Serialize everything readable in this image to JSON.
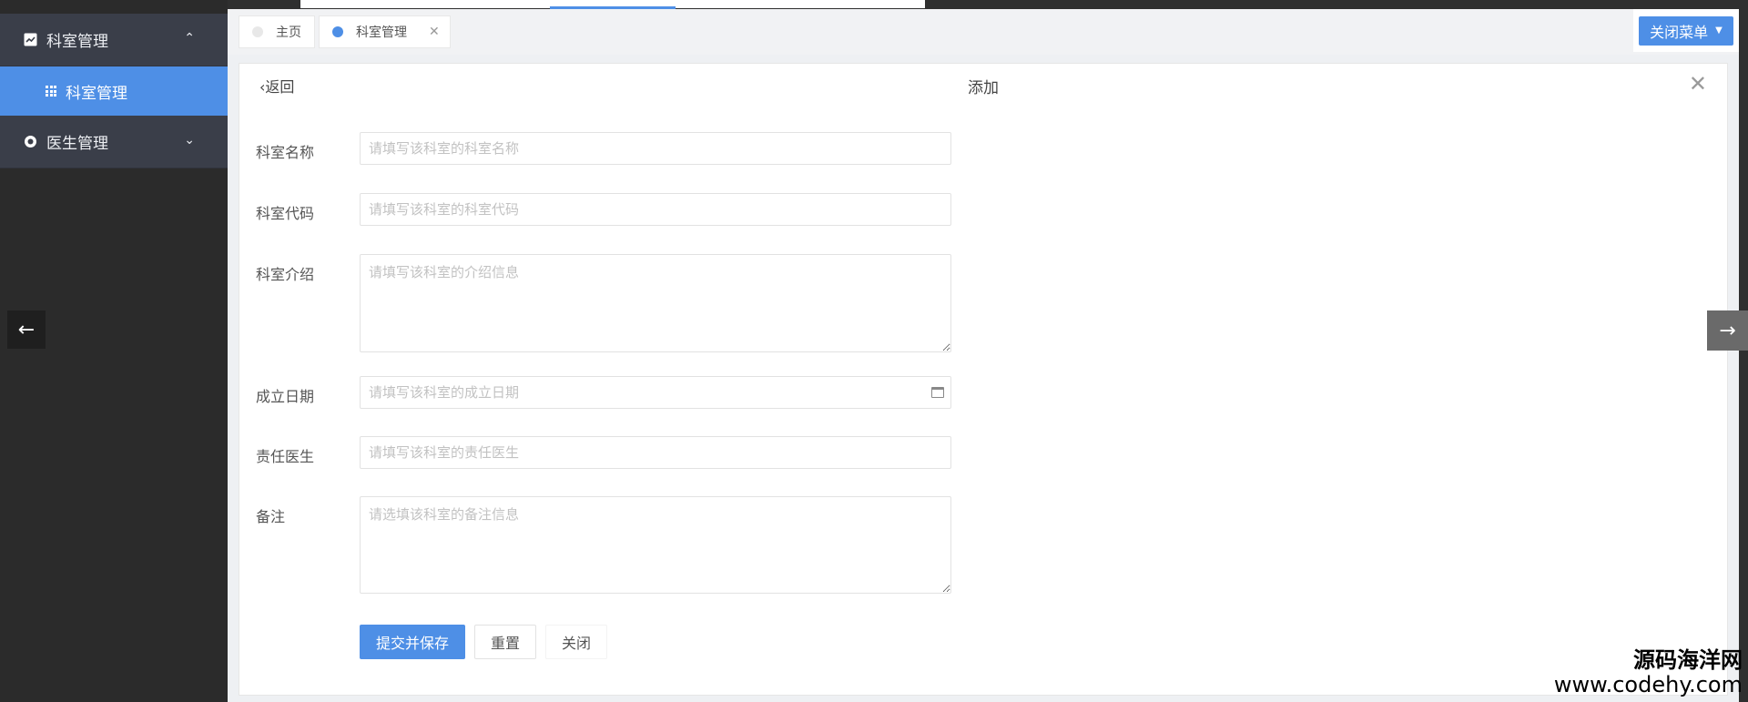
{
  "sidebar": {
    "groups": [
      {
        "label": "科室管理",
        "icon": "chart-icon",
        "expanded": true
      },
      {
        "label": "医生管理",
        "icon": "doctor-icon",
        "expanded": false
      }
    ],
    "active_item": {
      "label": "科室管理",
      "icon": "grid-icon"
    }
  },
  "tabs": [
    {
      "label": "主页",
      "dot_color": "#e8e8e8"
    },
    {
      "label": "科室管理",
      "dot_color": "#4e8fe6",
      "closable": true
    }
  ],
  "close_menu_label": "关闭菜单",
  "panel": {
    "back_label": "返回",
    "title": "添加"
  },
  "form": {
    "fields": [
      {
        "label": "科室名称",
        "placeholder": "请填写该科室的科室名称",
        "type": "input"
      },
      {
        "label": "科室代码",
        "placeholder": "请填写该科室的科室代码",
        "type": "input"
      },
      {
        "label": "科室介绍",
        "placeholder": "请填写该科室的介绍信息",
        "type": "textarea"
      },
      {
        "label": "成立日期",
        "placeholder": "请填写该科室的成立日期",
        "type": "date"
      },
      {
        "label": "责任医生",
        "placeholder": "请填写该科室的责任医生",
        "type": "input"
      },
      {
        "label": "备注",
        "placeholder": "请选填该科室的备注信息",
        "type": "textarea"
      }
    ],
    "buttons": {
      "submit": "提交并保存",
      "reset": "重置",
      "close": "关闭"
    }
  },
  "watermark": {
    "cn": "源码海洋网",
    "en": "www.codehy.com"
  },
  "colors": {
    "accent": "#4e8fe6",
    "sidebar_bg": "#3a3e49"
  }
}
